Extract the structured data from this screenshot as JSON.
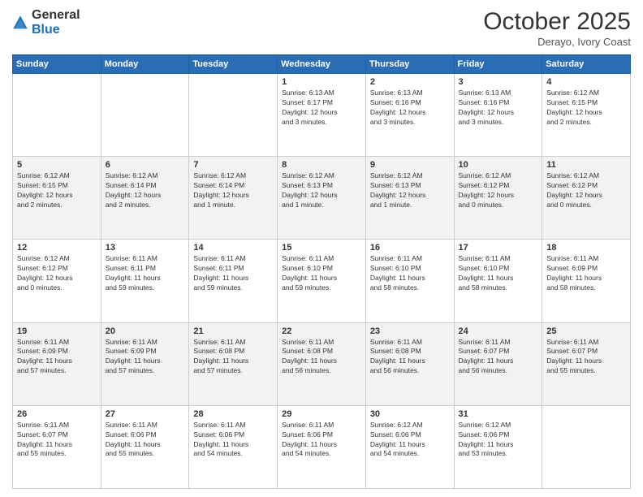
{
  "header": {
    "logo": {
      "general": "General",
      "blue": "Blue"
    },
    "title": "October 2025",
    "location": "Derayo, Ivory Coast"
  },
  "days_of_week": [
    "Sunday",
    "Monday",
    "Tuesday",
    "Wednesday",
    "Thursday",
    "Friday",
    "Saturday"
  ],
  "weeks": [
    [
      {
        "day": "",
        "info": ""
      },
      {
        "day": "",
        "info": ""
      },
      {
        "day": "",
        "info": ""
      },
      {
        "day": "1",
        "info": "Sunrise: 6:13 AM\nSunset: 6:17 PM\nDaylight: 12 hours\nand 3 minutes."
      },
      {
        "day": "2",
        "info": "Sunrise: 6:13 AM\nSunset: 6:16 PM\nDaylight: 12 hours\nand 3 minutes."
      },
      {
        "day": "3",
        "info": "Sunrise: 6:13 AM\nSunset: 6:16 PM\nDaylight: 12 hours\nand 3 minutes."
      },
      {
        "day": "4",
        "info": "Sunrise: 6:12 AM\nSunset: 6:15 PM\nDaylight: 12 hours\nand 2 minutes."
      }
    ],
    [
      {
        "day": "5",
        "info": "Sunrise: 6:12 AM\nSunset: 6:15 PM\nDaylight: 12 hours\nand 2 minutes."
      },
      {
        "day": "6",
        "info": "Sunrise: 6:12 AM\nSunset: 6:14 PM\nDaylight: 12 hours\nand 2 minutes."
      },
      {
        "day": "7",
        "info": "Sunrise: 6:12 AM\nSunset: 6:14 PM\nDaylight: 12 hours\nand 1 minute."
      },
      {
        "day": "8",
        "info": "Sunrise: 6:12 AM\nSunset: 6:13 PM\nDaylight: 12 hours\nand 1 minute."
      },
      {
        "day": "9",
        "info": "Sunrise: 6:12 AM\nSunset: 6:13 PM\nDaylight: 12 hours\nand 1 minute."
      },
      {
        "day": "10",
        "info": "Sunrise: 6:12 AM\nSunset: 6:12 PM\nDaylight: 12 hours\nand 0 minutes."
      },
      {
        "day": "11",
        "info": "Sunrise: 6:12 AM\nSunset: 6:12 PM\nDaylight: 12 hours\nand 0 minutes."
      }
    ],
    [
      {
        "day": "12",
        "info": "Sunrise: 6:12 AM\nSunset: 6:12 PM\nDaylight: 12 hours\nand 0 minutes."
      },
      {
        "day": "13",
        "info": "Sunrise: 6:11 AM\nSunset: 6:11 PM\nDaylight: 11 hours\nand 59 minutes."
      },
      {
        "day": "14",
        "info": "Sunrise: 6:11 AM\nSunset: 6:11 PM\nDaylight: 11 hours\nand 59 minutes."
      },
      {
        "day": "15",
        "info": "Sunrise: 6:11 AM\nSunset: 6:10 PM\nDaylight: 11 hours\nand 59 minutes."
      },
      {
        "day": "16",
        "info": "Sunrise: 6:11 AM\nSunset: 6:10 PM\nDaylight: 11 hours\nand 58 minutes."
      },
      {
        "day": "17",
        "info": "Sunrise: 6:11 AM\nSunset: 6:10 PM\nDaylight: 11 hours\nand 58 minutes."
      },
      {
        "day": "18",
        "info": "Sunrise: 6:11 AM\nSunset: 6:09 PM\nDaylight: 11 hours\nand 58 minutes."
      }
    ],
    [
      {
        "day": "19",
        "info": "Sunrise: 6:11 AM\nSunset: 6:09 PM\nDaylight: 11 hours\nand 57 minutes."
      },
      {
        "day": "20",
        "info": "Sunrise: 6:11 AM\nSunset: 6:09 PM\nDaylight: 11 hours\nand 57 minutes."
      },
      {
        "day": "21",
        "info": "Sunrise: 6:11 AM\nSunset: 6:08 PM\nDaylight: 11 hours\nand 57 minutes."
      },
      {
        "day": "22",
        "info": "Sunrise: 6:11 AM\nSunset: 6:08 PM\nDaylight: 11 hours\nand 56 minutes."
      },
      {
        "day": "23",
        "info": "Sunrise: 6:11 AM\nSunset: 6:08 PM\nDaylight: 11 hours\nand 56 minutes."
      },
      {
        "day": "24",
        "info": "Sunrise: 6:11 AM\nSunset: 6:07 PM\nDaylight: 11 hours\nand 56 minutes."
      },
      {
        "day": "25",
        "info": "Sunrise: 6:11 AM\nSunset: 6:07 PM\nDaylight: 11 hours\nand 55 minutes."
      }
    ],
    [
      {
        "day": "26",
        "info": "Sunrise: 6:11 AM\nSunset: 6:07 PM\nDaylight: 11 hours\nand 55 minutes."
      },
      {
        "day": "27",
        "info": "Sunrise: 6:11 AM\nSunset: 6:06 PM\nDaylight: 11 hours\nand 55 minutes."
      },
      {
        "day": "28",
        "info": "Sunrise: 6:11 AM\nSunset: 6:06 PM\nDaylight: 11 hours\nand 54 minutes."
      },
      {
        "day": "29",
        "info": "Sunrise: 6:11 AM\nSunset: 6:06 PM\nDaylight: 11 hours\nand 54 minutes."
      },
      {
        "day": "30",
        "info": "Sunrise: 6:12 AM\nSunset: 6:06 PM\nDaylight: 11 hours\nand 54 minutes."
      },
      {
        "day": "31",
        "info": "Sunrise: 6:12 AM\nSunset: 6:06 PM\nDaylight: 11 hours\nand 53 minutes."
      },
      {
        "day": "",
        "info": ""
      }
    ]
  ]
}
